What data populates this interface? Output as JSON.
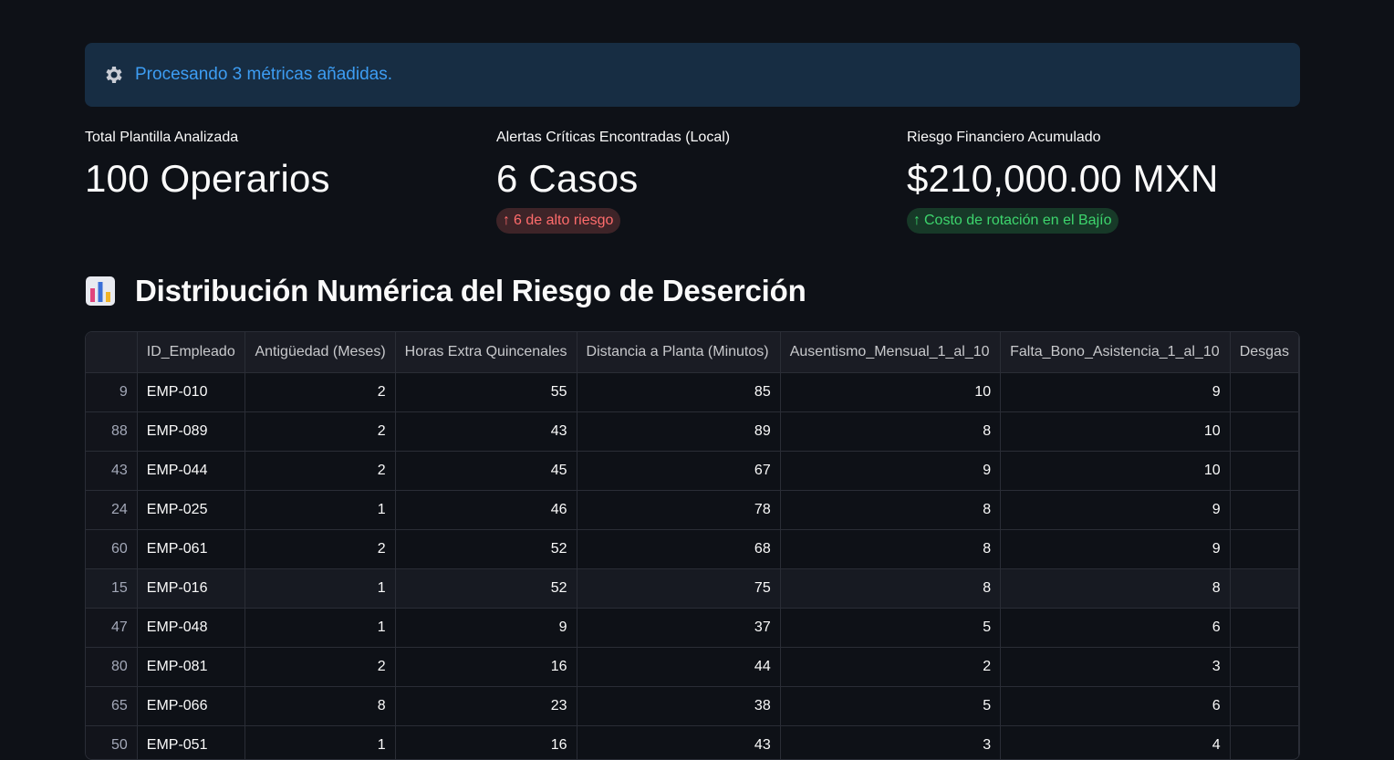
{
  "info": {
    "icon": "gear-icon",
    "message": "Procesando 3 métricas añadidas."
  },
  "metrics": [
    {
      "label": "Total Plantilla Analizada",
      "value": "100 Operarios"
    },
    {
      "label": "Alertas Críticas Encontradas (Local)",
      "value": "6 Casos",
      "delta": "6 de alto riesgo",
      "delta_color": "#ff6c6c"
    },
    {
      "label": "Riesgo Financiero Acumulado",
      "value": "$210,000.00 MXN",
      "delta": "Costo de rotación en el Bajío",
      "delta_color": "#3dd56d"
    }
  ],
  "section": {
    "icon": "bar-chart-icon",
    "title": "Distribución Numérica del Riesgo de Deserción"
  },
  "table": {
    "columns": [
      "",
      "ID_Empleado",
      "Antigüedad (Meses)",
      "Horas Extra Quincenales",
      "Distancia a Planta (Minutos)",
      "Ausentismo_Mensual_1_al_10",
      "Falta_Bono_Asistencia_1_al_10",
      "Desgas"
    ],
    "rows": [
      [
        "9",
        "EMP-010",
        "2",
        "55",
        "85",
        "10",
        "9",
        ""
      ],
      [
        "88",
        "EMP-089",
        "2",
        "43",
        "89",
        "8",
        "10",
        ""
      ],
      [
        "43",
        "EMP-044",
        "2",
        "45",
        "67",
        "9",
        "10",
        ""
      ],
      [
        "24",
        "EMP-025",
        "1",
        "46",
        "78",
        "8",
        "9",
        ""
      ],
      [
        "60",
        "EMP-061",
        "2",
        "52",
        "68",
        "8",
        "9",
        ""
      ],
      [
        "15",
        "EMP-016",
        "1",
        "52",
        "75",
        "8",
        "8",
        ""
      ],
      [
        "47",
        "EMP-048",
        "1",
        "9",
        "37",
        "5",
        "6",
        ""
      ],
      [
        "80",
        "EMP-081",
        "2",
        "16",
        "44",
        "2",
        "3",
        ""
      ],
      [
        "65",
        "EMP-066",
        "8",
        "23",
        "38",
        "5",
        "6",
        ""
      ],
      [
        "50",
        "EMP-051",
        "1",
        "16",
        "43",
        "3",
        "4",
        ""
      ]
    ]
  }
}
